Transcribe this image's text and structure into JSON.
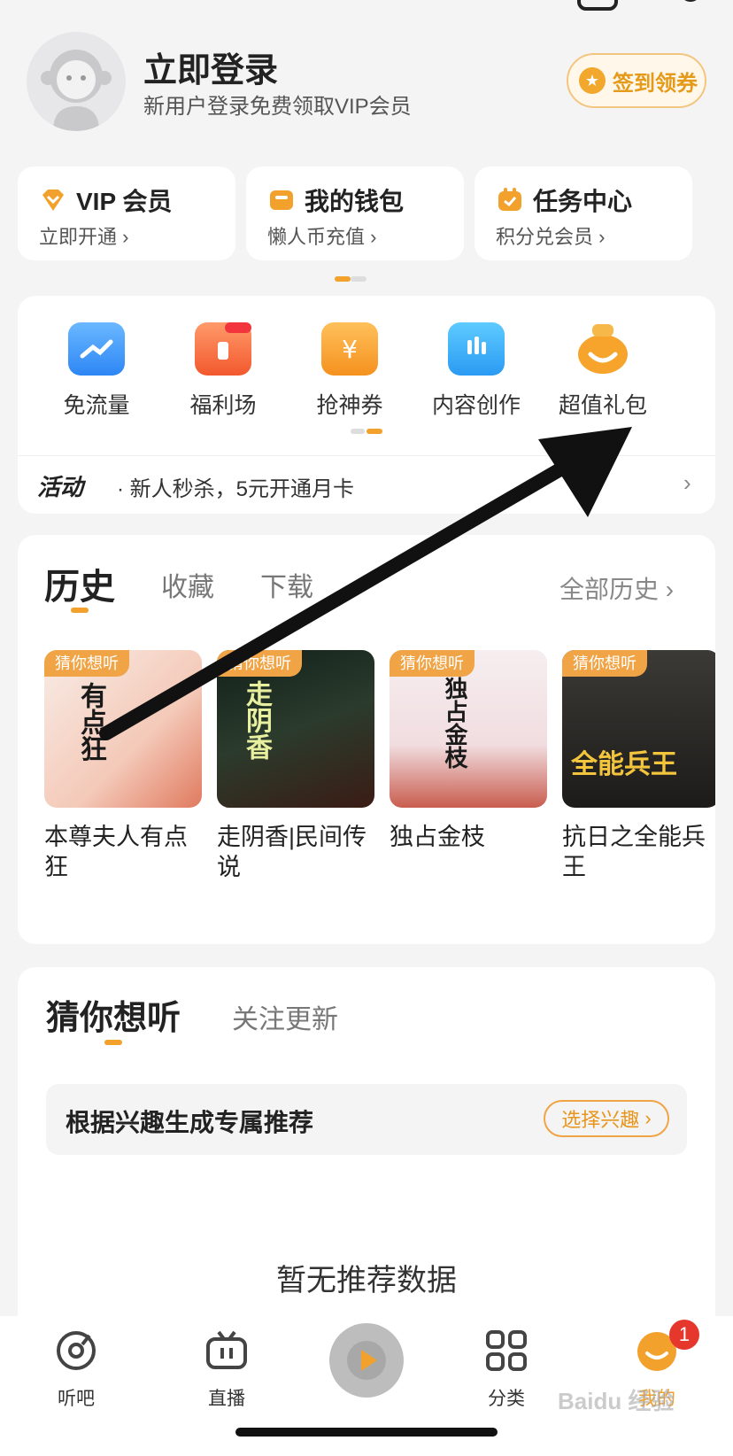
{
  "header": {
    "login_title": "立即登录",
    "login_subtitle": "新用户登录免费领取VIP会员",
    "signin_label": "签到领券"
  },
  "cards": [
    {
      "title": "VIP 会员",
      "subtitle": "立即开通",
      "icon": "vip-diamond-icon"
    },
    {
      "title": "我的钱包",
      "subtitle": "懒人币充值",
      "icon": "wallet-icon"
    },
    {
      "title": "任务中心",
      "subtitle": "积分兑会员",
      "icon": "task-calendar-icon"
    }
  ],
  "services": [
    {
      "label": "免流量",
      "icon": "free-data-icon"
    },
    {
      "label": "福利场",
      "icon": "gift-box-icon"
    },
    {
      "label": "抢神券",
      "icon": "coupon-icon"
    },
    {
      "label": "内容创作",
      "icon": "creation-icon"
    },
    {
      "label": "超值礼包",
      "icon": "gift-bag-icon"
    }
  ],
  "activity": {
    "tag": "活动",
    "text": "· 新人秒杀，5元开通月卡"
  },
  "history": {
    "tabs": [
      "历史",
      "收藏",
      "下载"
    ],
    "all_label": "全部历史",
    "books": [
      {
        "badge": "猜你想听",
        "name": "本尊夫人有点狂",
        "cover_text": "有点狂"
      },
      {
        "badge": "猜你想听",
        "name": "走阴香|民间传说",
        "cover_text": "走阴香"
      },
      {
        "badge": "猜你想听",
        "name": "独占金枝",
        "cover_text": "独占金枝"
      },
      {
        "badge": "猜你想听",
        "name": "抗日之全能兵王",
        "cover_text": "全能兵王"
      }
    ]
  },
  "guess": {
    "tabs": [
      "猜你想听",
      "关注更新"
    ],
    "interest_text": "根据兴趣生成专属推荐",
    "interest_button": "选择兴趣",
    "empty_text": "暂无推荐数据"
  },
  "nav": {
    "items": [
      {
        "label": "听吧",
        "icon": "listen-disc-icon"
      },
      {
        "label": "直播",
        "icon": "tv-live-icon"
      },
      {
        "label": "分类",
        "icon": "category-grid-icon"
      },
      {
        "label": "我的",
        "icon": "profile-face-icon"
      }
    ],
    "badge": "1"
  },
  "colors": {
    "accent": "#f2a12c",
    "brand_orange": "#f0a445",
    "badge_red": "#e6372d",
    "background": "#f4f4f5"
  }
}
